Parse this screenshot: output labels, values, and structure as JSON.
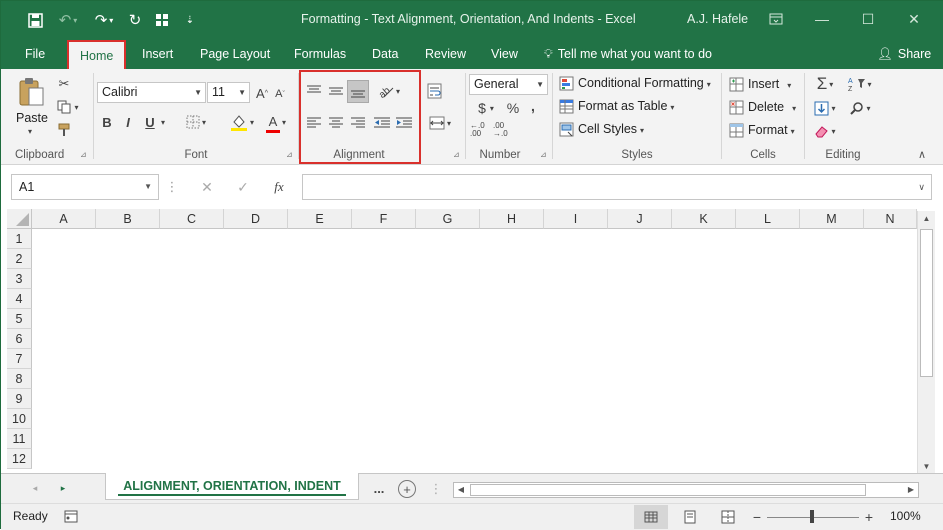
{
  "window": {
    "title": "Formatting - Text Alignment, Orientation, And Indents  -  Excel",
    "user": "A.J. Hafele"
  },
  "tabs": [
    "File",
    "Home",
    "Insert",
    "Page Layout",
    "Formulas",
    "Data",
    "Review",
    "View"
  ],
  "active_tab": "Home",
  "tell_me": "Tell me what you want to do",
  "share": "Share",
  "ribbon": {
    "clipboard": {
      "paste": "Paste",
      "label": "Clipboard"
    },
    "font": {
      "name": "Calibri",
      "size": "11",
      "bold": "B",
      "italic": "I",
      "underline": "U",
      "label": "Font"
    },
    "alignment": {
      "label": "Alignment"
    },
    "number": {
      "format": "General",
      "currency": "$",
      "percent": "%",
      "comma": ",",
      "increase_decimal": "←.0 .00",
      "decrease_decimal": ".00 →.0",
      "label": "Number"
    },
    "styles": {
      "conditional": "Conditional Formatting",
      "table": "Format as Table",
      "cell_styles": "Cell Styles",
      "label": "Styles"
    },
    "cells": {
      "insert": "Insert",
      "delete": "Delete",
      "format": "Format",
      "label": "Cells"
    },
    "editing": {
      "label": "Editing"
    }
  },
  "formula_bar": {
    "name_box": "A1",
    "fx": "fx",
    "value": ""
  },
  "columns": [
    "A",
    "B",
    "C",
    "D",
    "E",
    "F",
    "G",
    "H",
    "I",
    "J",
    "K",
    "L",
    "M",
    "N"
  ],
  "rows": [
    "1",
    "2",
    "3",
    "4",
    "5",
    "6",
    "7",
    "8",
    "9",
    "10",
    "11",
    "12"
  ],
  "sheet_tab": "ALIGNMENT, ORIENTATION, INDENT",
  "sheet_more": "...",
  "status": {
    "ready": "Ready",
    "zoom": "100%"
  },
  "colors": {
    "accent": "#217346",
    "highlight": "#d9302c"
  }
}
